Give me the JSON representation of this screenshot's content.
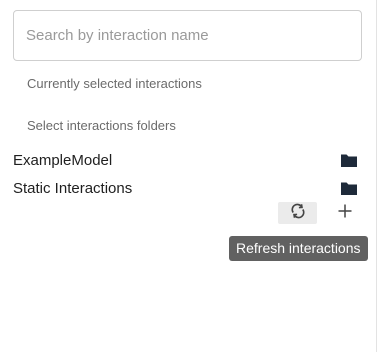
{
  "search": {
    "placeholder": "Search by interaction name",
    "value": ""
  },
  "sections": {
    "selected_label": "Currently selected interactions",
    "folders_label": "Select interactions folders"
  },
  "folders": [
    {
      "name": "ExampleModel",
      "icon": "folder-icon"
    },
    {
      "name": "Static Interactions",
      "icon": "folder-icon"
    }
  ],
  "toolbar": {
    "refresh_icon": "refresh-icon",
    "add_icon": "plus-icon"
  },
  "tooltip": {
    "text": "Refresh interactions"
  },
  "colors": {
    "folder_icon": "#1e2a3a",
    "tooltip_bg": "#616161",
    "refresh_bg": "#ebebeb"
  }
}
